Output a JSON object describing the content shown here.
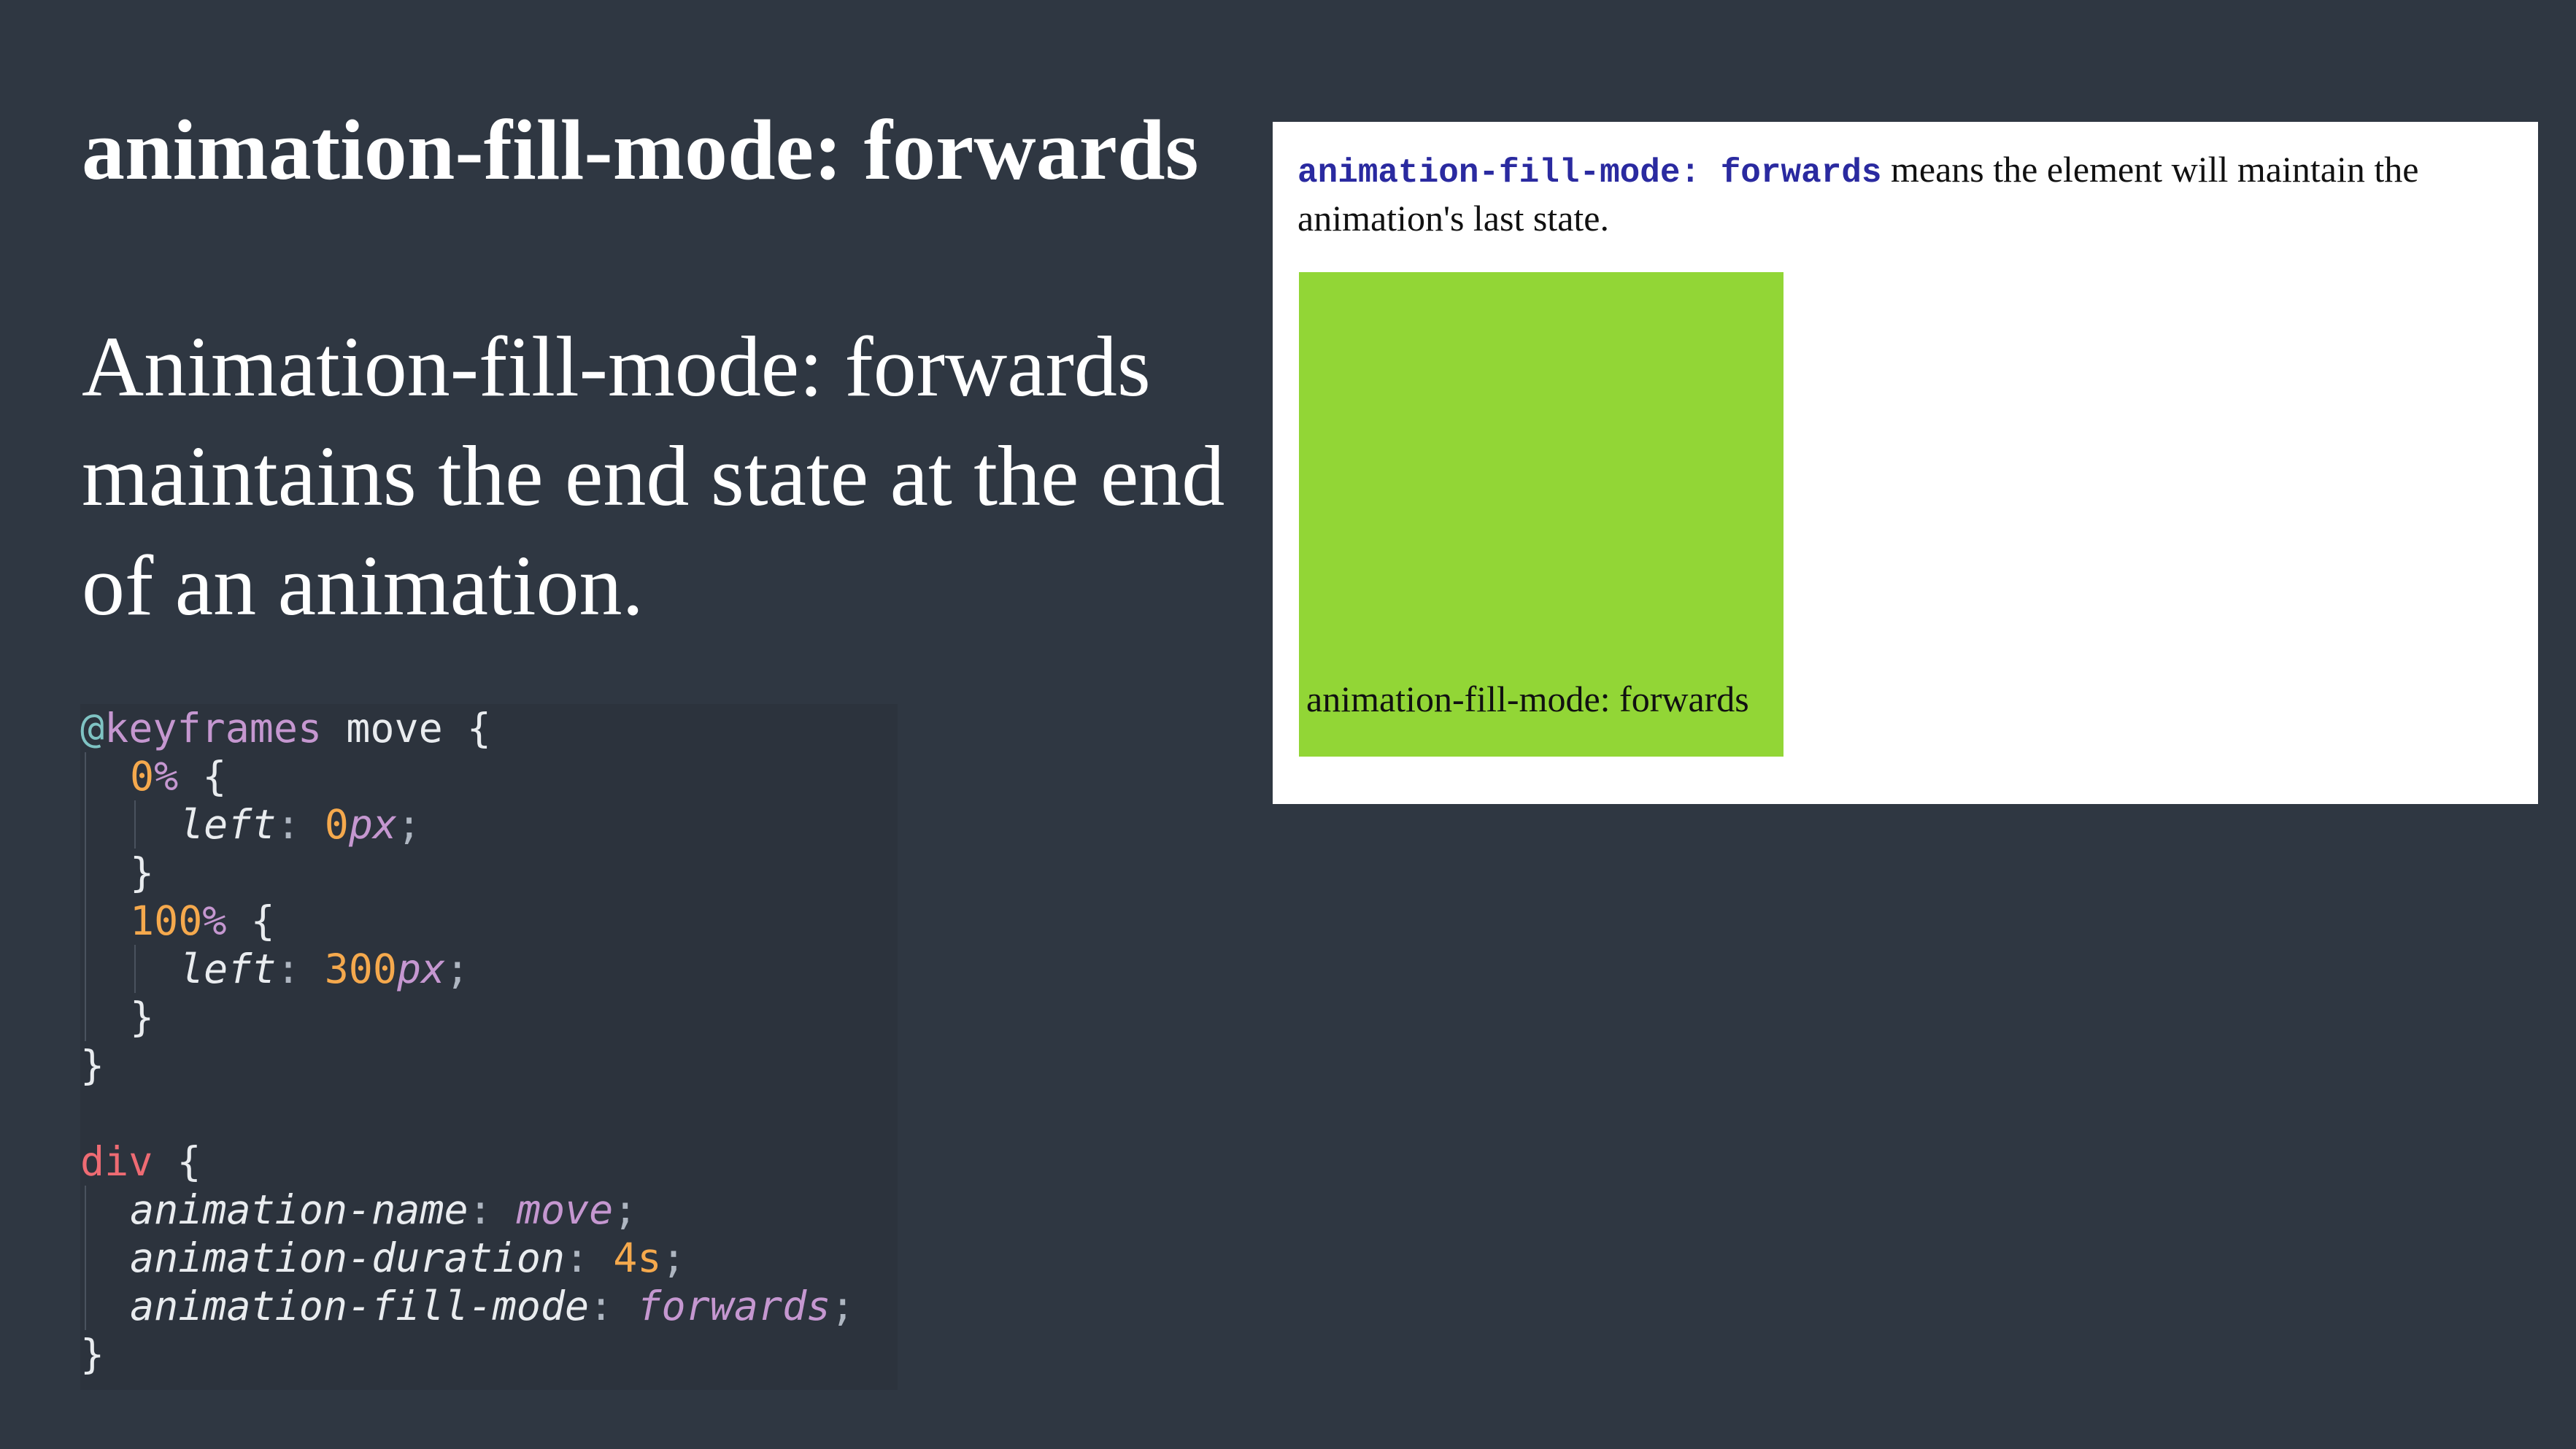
{
  "slide": {
    "title": "animation-fill-mode: forwards",
    "body": "Animation-fill-mode: forwards maintains the end state at the end of an animation."
  },
  "code": {
    "l1_at": "@",
    "l1_kw": "keyframes",
    "l1_name": " move ",
    "l1_brace": "{",
    "l2_pct": "0",
    "l2_sign": "%",
    "l2_brace": " {",
    "l3_prop": "left",
    "l3_colon": ": ",
    "l3_num": "0",
    "l3_unit": "px",
    "l3_semi": ";",
    "l4_close": "}",
    "l5_pct": "100",
    "l5_sign": "%",
    "l5_brace": " {",
    "l6_prop": "left",
    "l6_colon": ": ",
    "l6_num": "300",
    "l6_unit": "px",
    "l6_semi": ";",
    "l7_close": "}",
    "l8_close": "}",
    "l10_sel": "div",
    "l10_brace": " {",
    "l11_prop": "animation-name",
    "l11_colon": ": ",
    "l11_val": "move",
    "l11_semi": ";",
    "l12_prop": "animation-duration",
    "l12_colon": ": ",
    "l12_num": "4",
    "l12_unit": "s",
    "l12_semi": ";",
    "l13_prop": "animation-fill-mode",
    "l13_colon": ": ",
    "l13_val": "forwards",
    "l13_semi": ";",
    "l14_close": "}"
  },
  "demo": {
    "code_text": "animation-fill-mode: forwards",
    "desc_text": " means the element will maintain the animation's last state.",
    "box_label": "animation-fill-mode: forwards",
    "box_color": "#92d636"
  },
  "colors": {
    "background": "#2f3742",
    "panel": "#ffffff"
  }
}
